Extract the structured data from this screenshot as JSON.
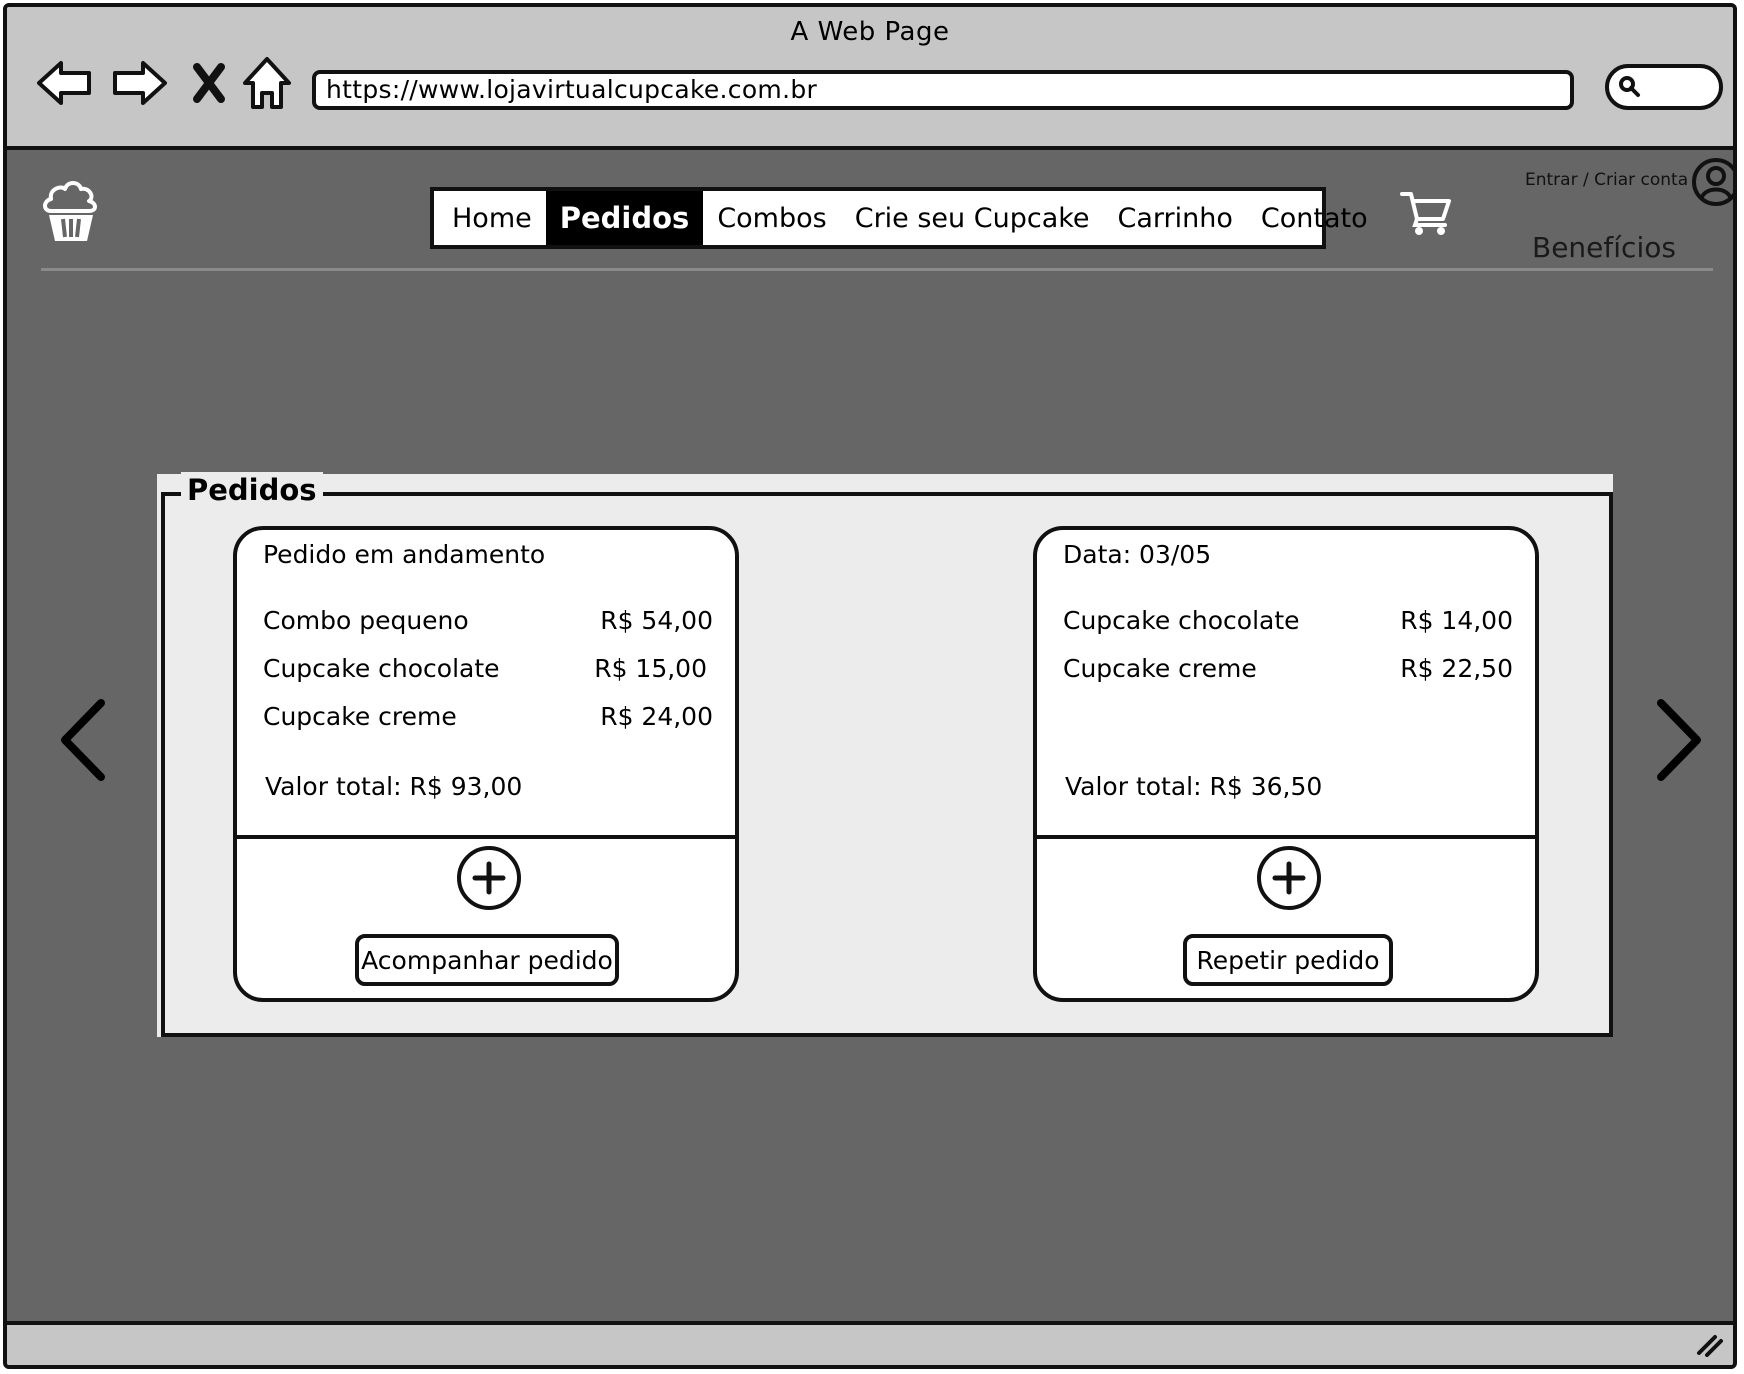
{
  "browser": {
    "title": "A Web Page",
    "url": "https://www.lojavirtualcupcake.com.br",
    "icons": [
      "back-arrow-icon",
      "forward-arrow-icon",
      "close-icon",
      "home-icon",
      "search-icon"
    ]
  },
  "header": {
    "logo_icon": "cupcake-icon",
    "menu": [
      {
        "label": "Home",
        "active": false
      },
      {
        "label": "Pedidos",
        "active": true
      },
      {
        "label": "Combos",
        "active": false
      },
      {
        "label": "Crie seu Cupcake",
        "active": false
      },
      {
        "label": "Carrinho",
        "active": false
      },
      {
        "label": "Contato",
        "active": false
      }
    ],
    "cart_icon": "cart-icon",
    "login_label": "Entrar / Criar conta",
    "user_icon": "user-circle-icon",
    "benefits_label": "Benefícios"
  },
  "orders": {
    "title": "Pedidos",
    "cards": [
      {
        "header": "Pedido em andamento",
        "items": [
          {
            "name": "Combo pequeno",
            "price": "R$ 54,00"
          },
          {
            "name": "Cupcake chocolate",
            "price": "R$ 15,00"
          },
          {
            "name": "Cupcake creme",
            "price": "R$ 24,00"
          }
        ],
        "total": "Valor total: R$ 93,00",
        "action": "Acompanhar pedido"
      },
      {
        "header": "Data: 03/05",
        "items": [
          {
            "name": "Cupcake chocolate",
            "price": "R$ 14,00"
          },
          {
            "name": "Cupcake creme",
            "price": "R$ 22,50"
          }
        ],
        "total": "Valor total: R$ 36,50",
        "action": "Repetir pedido"
      }
    ]
  }
}
